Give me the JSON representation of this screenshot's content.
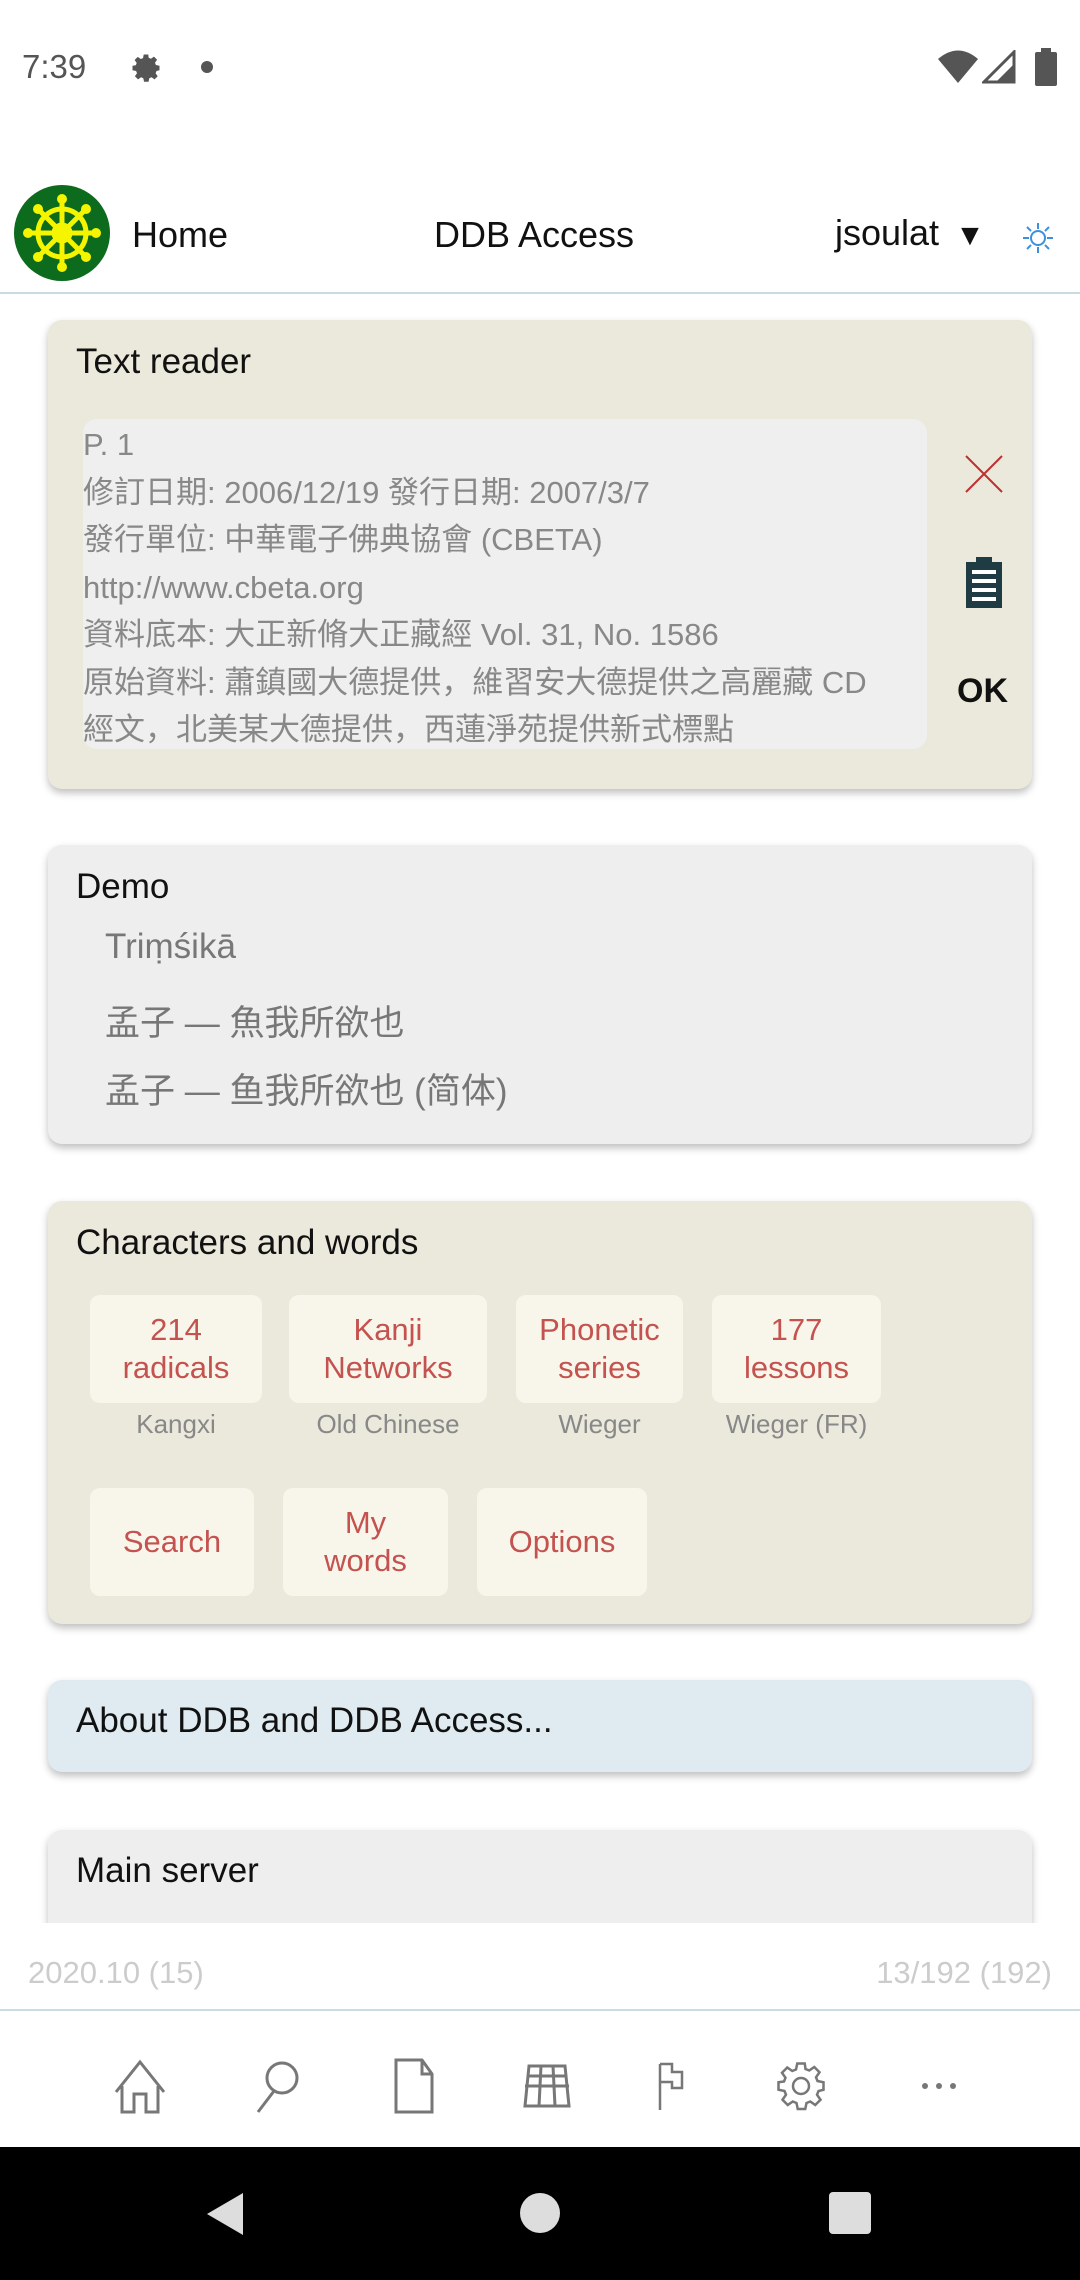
{
  "status_bar": {
    "time": "7:39",
    "icons": [
      "gear-icon",
      "dot-icon",
      "wifi-icon",
      "signal-icon",
      "battery-icon"
    ]
  },
  "header": {
    "home": "Home",
    "title": "DDB Access",
    "user": "jsoulat",
    "dropdown": "▼",
    "logo": "dharma-wheel-logo",
    "theme_icon": "sun-icon"
  },
  "text_reader": {
    "title": "Text reader",
    "lines": [
      "P. 1",
      "修訂日期: 2006/12/19  發行日期: 2007/3/7",
      "發行單位: 中華電子佛典協會 (CBETA)",
      "http://www.cbeta.org",
      "資料底本: 大正新脩大正藏經 Vol. 31, No. 1586",
      "原始資料: 蕭鎮國大德提供，維習安大德提供之高麗藏 CD",
      "經文，北美某大德提供，西蓮淨苑提供新式標點"
    ],
    "ok_label": "OK"
  },
  "demo": {
    "title": "Demo",
    "items": [
      "Triṃśikā",
      "孟子 — 魚我所欲也",
      "孟子 — 鱼我所欲也 (简体)"
    ]
  },
  "characters": {
    "title": "Characters and words",
    "tiles": [
      {
        "label1": "214",
        "label2": "radicals",
        "sub": "Kangxi"
      },
      {
        "label1": "Kanji",
        "label2": "Networks",
        "sub": "Old Chinese"
      },
      {
        "label1": "Phonetic",
        "label2": "series",
        "sub": "Wieger"
      },
      {
        "label1": "177",
        "label2": "lessons",
        "sub": "Wieger (FR)"
      }
    ],
    "buttons": [
      {
        "label1": "Search",
        "label2": ""
      },
      {
        "label1": "My",
        "label2": "words"
      },
      {
        "label1": "Options",
        "label2": ""
      }
    ]
  },
  "about": {
    "title": "About DDB and DDB Access..."
  },
  "main_server": {
    "title": "Main server"
  },
  "footer": {
    "left": "2020.10 (15)",
    "right": "13/192 (192)"
  },
  "bottom_nav": [
    "home-icon",
    "search-icon",
    "document-icon",
    "grid-icon",
    "flag-icon",
    "settings-icon",
    "more-icon"
  ],
  "colors": {
    "accent": "#c4524f",
    "card_beige": "#ebe9dc",
    "about_bg": "#dfebf0",
    "logo_green": "#0d6b1d",
    "logo_yellow": "#f5f500"
  }
}
